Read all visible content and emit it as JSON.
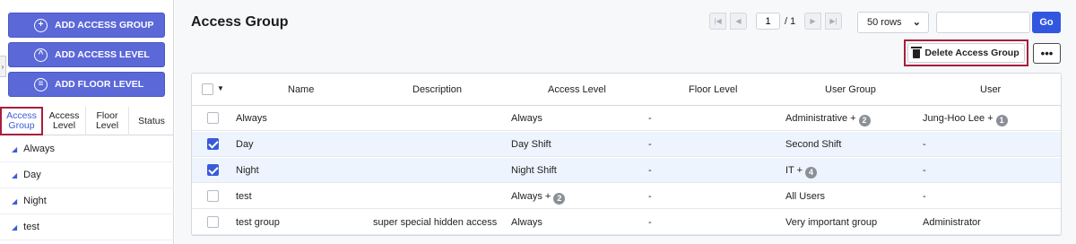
{
  "sidebar": {
    "buttons": [
      {
        "label": "ADD ACCESS GROUP",
        "icon": "plus-circle-icon"
      },
      {
        "label": "ADD ACCESS LEVEL",
        "icon": "chevron-up-circle-icon"
      },
      {
        "label": "ADD FLOOR LEVEL",
        "icon": "layers-circle-icon"
      }
    ],
    "tabs": [
      {
        "label": "Access\nGroup",
        "active": true
      },
      {
        "label": "Access\nLevel",
        "active": false
      },
      {
        "label": "Floor\nLevel",
        "active": false
      },
      {
        "label": "Status",
        "active": false
      }
    ],
    "items": [
      {
        "label": "Always"
      },
      {
        "label": "Day"
      },
      {
        "label": "Night"
      },
      {
        "label": "test"
      }
    ]
  },
  "header": {
    "title": "Access Group",
    "pagination": {
      "current": "1",
      "total": "/ 1"
    },
    "rows_per_page": "50 rows",
    "search_value": "",
    "go_label": "Go",
    "delete_label": "Delete Access Group",
    "more_label": "•••"
  },
  "table": {
    "columns": [
      "Name",
      "Description",
      "Access Level",
      "Floor Level",
      "User Group",
      "User"
    ],
    "rows": [
      {
        "checked": false,
        "name": "Always",
        "description": "",
        "access_level": "Always",
        "access_level_badge": "",
        "floor_level": "-",
        "user_group": "Administrative +",
        "user_group_badge": "2",
        "user": "Jung-Hoo Lee +",
        "user_badge": "1"
      },
      {
        "checked": true,
        "name": "Day",
        "description": "",
        "access_level": "Day Shift",
        "access_level_badge": "",
        "floor_level": "-",
        "user_group": "Second Shift",
        "user_group_badge": "",
        "user": "-",
        "user_badge": ""
      },
      {
        "checked": true,
        "name": "Night",
        "description": "",
        "access_level": "Night Shift",
        "access_level_badge": "",
        "floor_level": "-",
        "user_group": "IT +",
        "user_group_badge": "4",
        "user": "-",
        "user_badge": ""
      },
      {
        "checked": false,
        "name": "test",
        "description": "",
        "access_level": "Always +",
        "access_level_badge": "2",
        "floor_level": "-",
        "user_group": "All Users",
        "user_group_badge": "",
        "user": "-",
        "user_badge": ""
      },
      {
        "checked": false,
        "name": "test group",
        "description": "super special hidden access",
        "access_level": "Always",
        "access_level_badge": "",
        "floor_level": "-",
        "user_group": "Very important group",
        "user_group_badge": "",
        "user": "Administrator",
        "user_badge": ""
      }
    ]
  },
  "colors": {
    "primary_button": "#5b68d8",
    "go_button": "#3157e0",
    "highlight_border": "#a81e3b",
    "selected_row": "#eef4fd",
    "badge": "#8b8f97"
  }
}
